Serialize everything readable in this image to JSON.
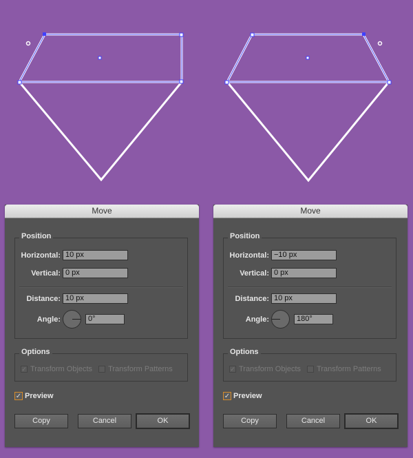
{
  "colors": {
    "background": "#8b59a7",
    "dialog": "#535353",
    "accent_orange": "#d68b2a",
    "selection_blue": "#4040ff"
  },
  "diagrams": [
    {
      "name": "diamond-moved-right",
      "selected_edge": "right"
    },
    {
      "name": "diamond-moved-left",
      "selected_edge": "left"
    }
  ],
  "dialogs": [
    {
      "title": "Move",
      "position_legend": "Position",
      "horizontal_label": "Horizontal:",
      "horizontal_value": "10 px",
      "vertical_label": "Vertical:",
      "vertical_value": "0 px",
      "distance_label": "Distance:",
      "distance_value": "10 px",
      "angle_label": "Angle:",
      "angle_value": "0°",
      "angle_degrees": 0,
      "options_legend": "Options",
      "transform_objects": {
        "label": "Transform Objects",
        "checked": true,
        "enabled": false
      },
      "transform_patterns": {
        "label": "Transform Patterns",
        "checked": false,
        "enabled": false
      },
      "preview": {
        "label": "Preview",
        "checked": true
      },
      "buttons": {
        "copy": "Copy",
        "cancel": "Cancel",
        "ok": "OK"
      }
    },
    {
      "title": "Move",
      "position_legend": "Position",
      "horizontal_label": "Horizontal:",
      "horizontal_value": "−10 px",
      "vertical_label": "Vertical:",
      "vertical_value": "0 px",
      "distance_label": "Distance:",
      "distance_value": "10 px",
      "angle_label": "Angle:",
      "angle_value": "180°",
      "angle_degrees": 180,
      "options_legend": "Options",
      "transform_objects": {
        "label": "Transform Objects",
        "checked": true,
        "enabled": false
      },
      "transform_patterns": {
        "label": "Transform Patterns",
        "checked": false,
        "enabled": false
      },
      "preview": {
        "label": "Preview",
        "checked": true
      },
      "buttons": {
        "copy": "Copy",
        "cancel": "Cancel",
        "ok": "OK"
      }
    }
  ],
  "icons": {
    "check": "✓"
  }
}
